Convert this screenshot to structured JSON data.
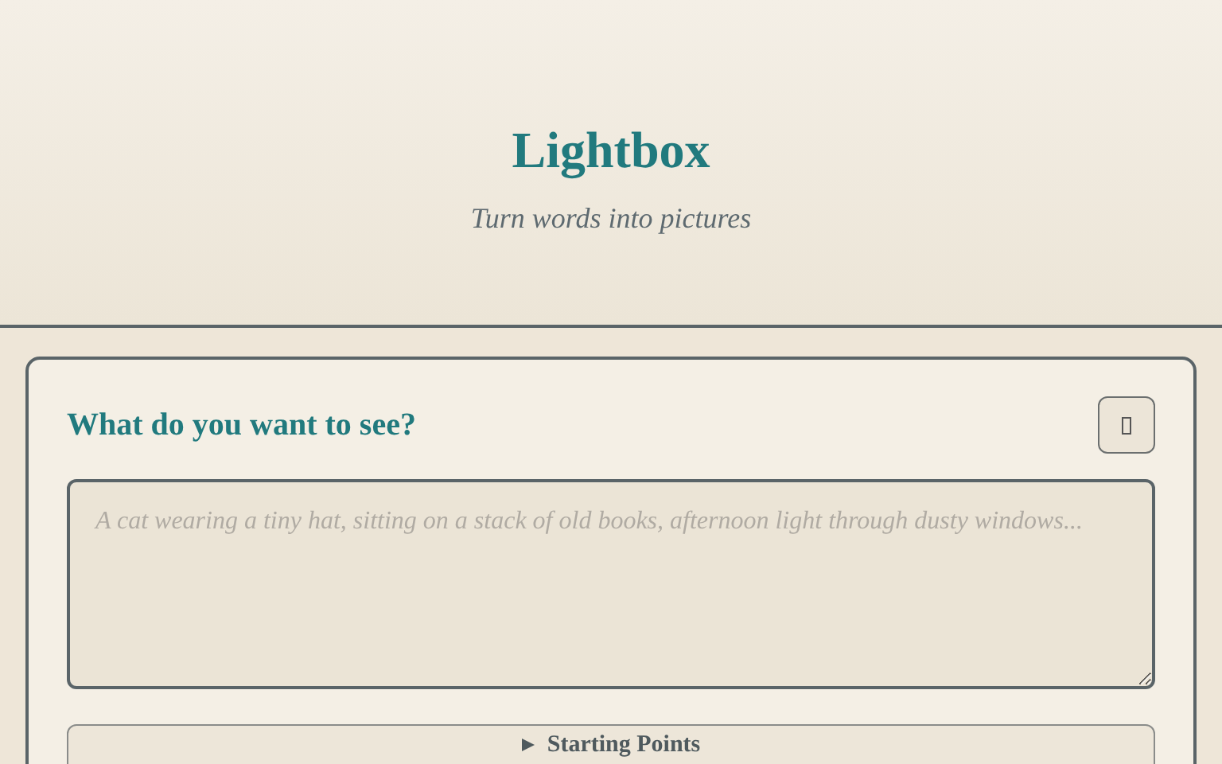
{
  "header": {
    "title": "Lightbox",
    "subtitle": "Turn words into pictures"
  },
  "prompt_card": {
    "heading": "What do you want to see?",
    "prompt_field": {
      "placeholder": "A cat wearing a tiny hat, sitting on a stack of old books, afternoon light through dusty windows..."
    },
    "starting_points": {
      "label": "Starting Points",
      "expanded": false
    }
  }
}
